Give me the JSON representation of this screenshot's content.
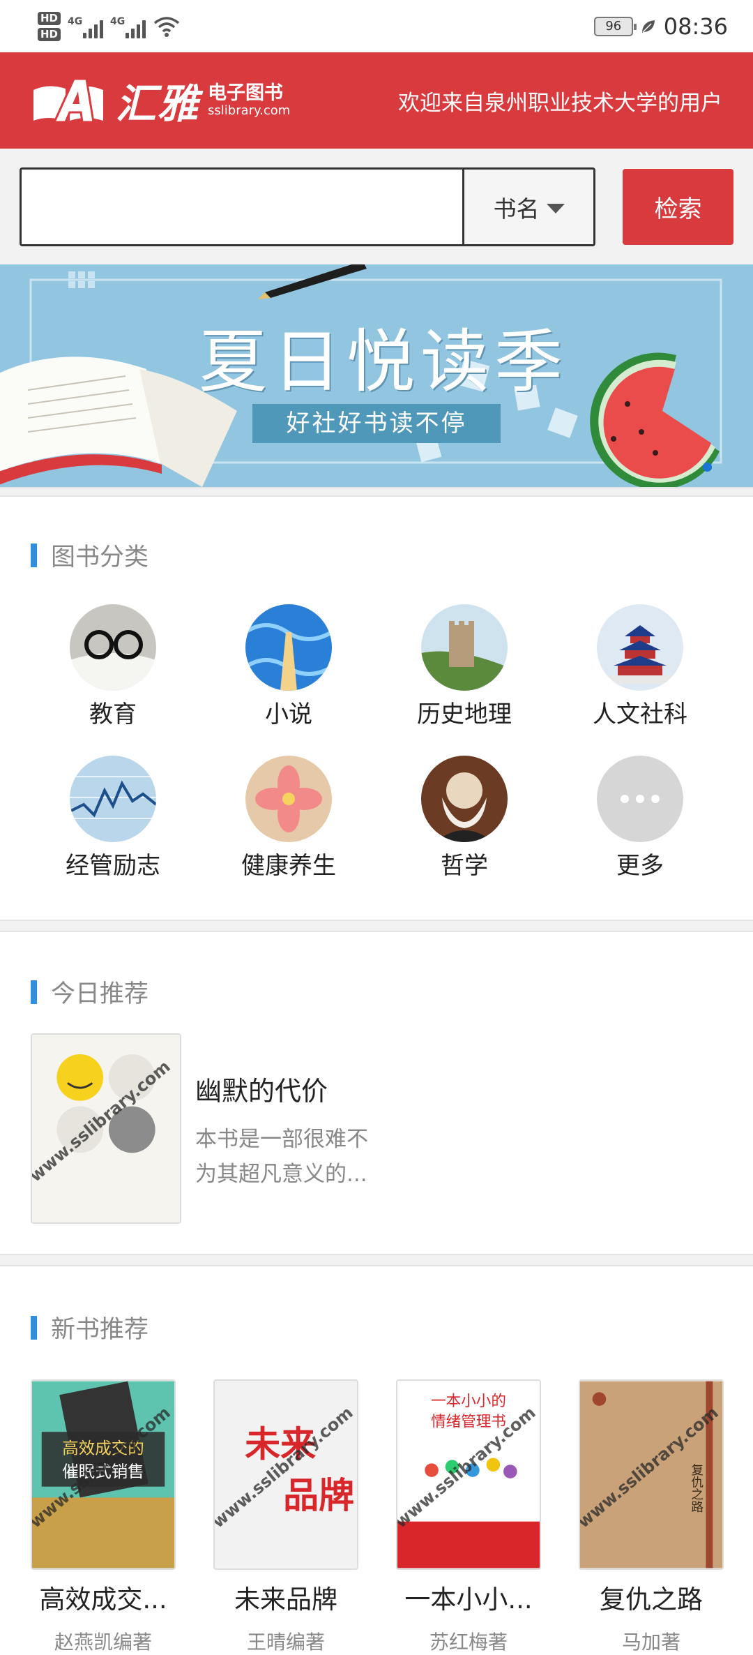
{
  "status_bar": {
    "hd1": "HD",
    "hd2": "HD",
    "net1": "4G",
    "net2": "4G",
    "battery": "96",
    "time": "08:36"
  },
  "header": {
    "logo_text": "汇雅",
    "logo_sub_cn": "电子图书",
    "logo_sub_en": "sslibrary.com",
    "welcome": "欢迎来自泉州职业技术大学的用户"
  },
  "search": {
    "placeholder": "",
    "type_label": "书名",
    "button_label": "检索"
  },
  "banner": {
    "title": "夏日悦读季",
    "subtitle": "好社好书读不停"
  },
  "categories": {
    "heading": "图书分类",
    "items": [
      {
        "label": "教育",
        "icon": "glasses-book-icon"
      },
      {
        "label": "小说",
        "icon": "fantasy-icon"
      },
      {
        "label": "历史地理",
        "icon": "great-wall-icon"
      },
      {
        "label": "人文社科",
        "icon": "temple-icon"
      },
      {
        "label": "经管励志",
        "icon": "stock-chart-icon"
      },
      {
        "label": "健康养生",
        "icon": "flower-icon"
      },
      {
        "label": "哲学",
        "icon": "portrait-icon"
      },
      {
        "label": "更多",
        "icon": "more-dots-icon"
      }
    ]
  },
  "today": {
    "heading": "今日推荐",
    "title": "幽默的代价",
    "desc": "本书是一部很难不为其超凡意义的...",
    "watermark": "www.sslibrary.com"
  },
  "new_books": {
    "heading": "新书推荐",
    "items": [
      {
        "title": "高效成交...",
        "author": "赵燕凯编著"
      },
      {
        "title": "未来品牌",
        "author": "王晴编著"
      },
      {
        "title": "一本小小...",
        "author": "苏红梅著"
      },
      {
        "title": "复仇之路",
        "author": "马加著"
      }
    ],
    "cover_texts": [
      "高效成交的",
      "催眠式销售",
      "未来",
      "品牌",
      "一本小小的",
      "情绪管理书",
      "复仇之路"
    ]
  },
  "colors": {
    "brand_red": "#d93a3e",
    "accent_blue": "#2f8fe3"
  }
}
